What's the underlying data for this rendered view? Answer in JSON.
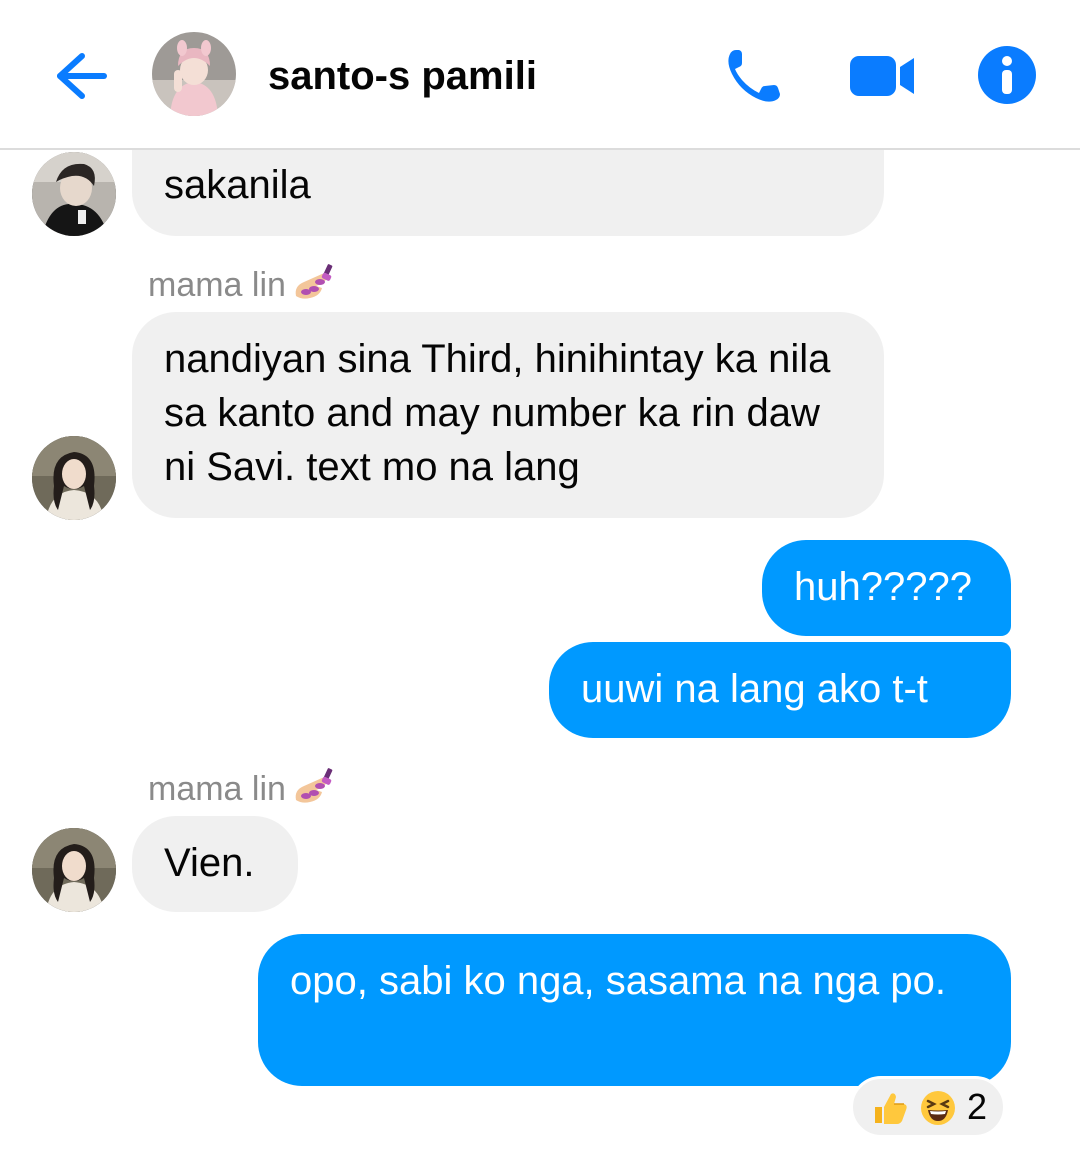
{
  "header": {
    "title": "santo-s pamili"
  },
  "messages": [
    {
      "sender": "",
      "text": "sakanila",
      "direction": "in"
    },
    {
      "sender": "mama lin",
      "text": "nandiyan sina Third, hinihintay ka nila sa kanto and may number ka rin daw ni Savi. text mo na lang",
      "direction": "in"
    },
    {
      "sender": "",
      "text": "huh?????",
      "direction": "out"
    },
    {
      "sender": "",
      "text": "uuwi na lang ako t-t",
      "direction": "out"
    },
    {
      "sender": "mama lin",
      "text": "Vien.",
      "direction": "in"
    },
    {
      "sender": "",
      "text": "opo, sabi ko nga, sasama na nga po.",
      "direction": "out"
    }
  ],
  "reactions": {
    "emojis": [
      "thumbs-up",
      "laughing"
    ],
    "count": "2"
  },
  "colors": {
    "accent": "#0099ff",
    "incoming_bubble": "#f0f0f0",
    "sender_text": "#8a8a8a"
  }
}
